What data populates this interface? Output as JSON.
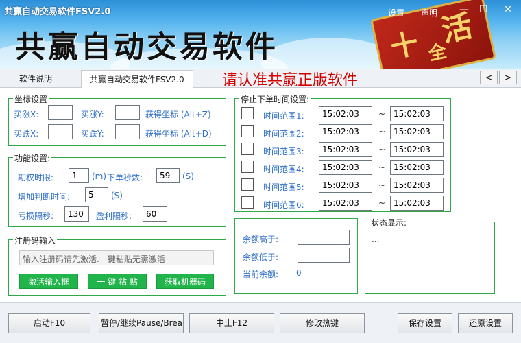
{
  "window": {
    "title": "共赢自动交易软件FSV2.0",
    "banner_title": "共赢自动交易软件",
    "links": {
      "settings": "设置",
      "statement": "声明"
    },
    "controls": {
      "minimize": "—",
      "maximize": "☐",
      "close": "✕"
    },
    "badge_text": [
      "十",
      "活",
      "全"
    ]
  },
  "tabs": [
    {
      "label": "软件说明"
    },
    {
      "label": "共赢自动交易软件FSV2.0"
    }
  ],
  "tab_notice": "请认准共赢正版软件",
  "nav": {
    "prev": "<",
    "next": ">"
  },
  "coords": {
    "title": "坐标设置",
    "buy_up_x": "买涨X:",
    "buy_up_y": "买涨Y:",
    "buy_down_x": "买跌X:",
    "buy_down_y": "买跌Y:",
    "get_coord_up": "获得坐标 (Alt+Z)",
    "get_coord_down": "获得坐标 (Alt+D)"
  },
  "func": {
    "title": "功能设置:",
    "expiry_label": "期权时限:",
    "expiry_value": "1",
    "expiry_unit": "(m)",
    "order_sec_label": "下单秒数:",
    "order_sec_value": "59",
    "order_sec_unit": "(S)",
    "judge_label": "增加判断时间:",
    "judge_value": "5",
    "judge_unit": "(S)",
    "loss_label": "亏损隔秒:",
    "loss_value": "130",
    "profit_label": "盈利隔秒:",
    "profit_value": "60"
  },
  "reg": {
    "title": "注册码输入",
    "placeholder": "输入注册码请先激活.一键粘贴无需激活",
    "activate_btn": "激活输入框",
    "paste_btn": "一 键 粘 贴",
    "machine_btn": "获取机器码"
  },
  "stop": {
    "title": "停止下单时间设置:",
    "rows": [
      {
        "label": "时间范围1:",
        "from": "15:02:03",
        "sep": "~",
        "to": "15:02:03"
      },
      {
        "label": "时间范围2:",
        "from": "15:02:03",
        "sep": "~",
        "to": "15:02:03"
      },
      {
        "label": "时间范围3:",
        "from": "15:02:03",
        "sep": "~",
        "to": "15:02:03"
      },
      {
        "label": "时间范围4:",
        "from": "15:02:03",
        "sep": "~",
        "to": "15:02:03"
      },
      {
        "label": "时间范围5:",
        "from": "15:02:03",
        "sep": "~",
        "to": "15:02:03"
      },
      {
        "label": "时间范围6:",
        "from": "15:02:03",
        "sep": "~",
        "to": "15:02:03"
      }
    ]
  },
  "balance": {
    "above_label": "余额高于:",
    "below_label": "余额低于:",
    "current_label": "当前余额:",
    "current_value": "0"
  },
  "status": {
    "title": "状态显示:",
    "text": "..."
  },
  "buttons": {
    "start": "启动F10",
    "pause": "暂停/继续Pause/Break",
    "stop": "中止F12",
    "hotkey": "修改热键",
    "save": "保存设置",
    "restore": "还原设置"
  },
  "colors": {
    "group_border": "#2fa84a",
    "label_blue": "#2f6fc6",
    "green_button": "#21b44a",
    "notice_red": "#d40000"
  }
}
